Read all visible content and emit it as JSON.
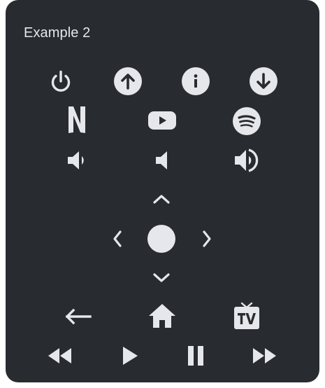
{
  "card": {
    "title": "Example 2"
  },
  "rows": {
    "power_row": [
      "power-icon",
      "arrow-up-circle-icon",
      "info-circle-icon",
      "arrow-down-circle-icon"
    ],
    "apps_row": [
      "netflix-icon",
      "youtube-icon",
      "spotify-icon"
    ],
    "volume_row": [
      "volume-down-icon",
      "volume-mute-icon",
      "volume-up-icon"
    ],
    "dpad": [
      "chevron-up-icon",
      "chevron-left-icon",
      "center-circle-icon",
      "chevron-right-icon",
      "chevron-down-icon"
    ],
    "nav_row": [
      "back-arrow-icon",
      "home-icon",
      "tv-icon"
    ],
    "media_row": [
      "rewind-icon",
      "play-icon",
      "pause-icon",
      "fast-forward-icon"
    ]
  },
  "colors": {
    "card_background": "#282b2f",
    "icon": "#e6e7ea",
    "page_background": "#ffffff"
  }
}
